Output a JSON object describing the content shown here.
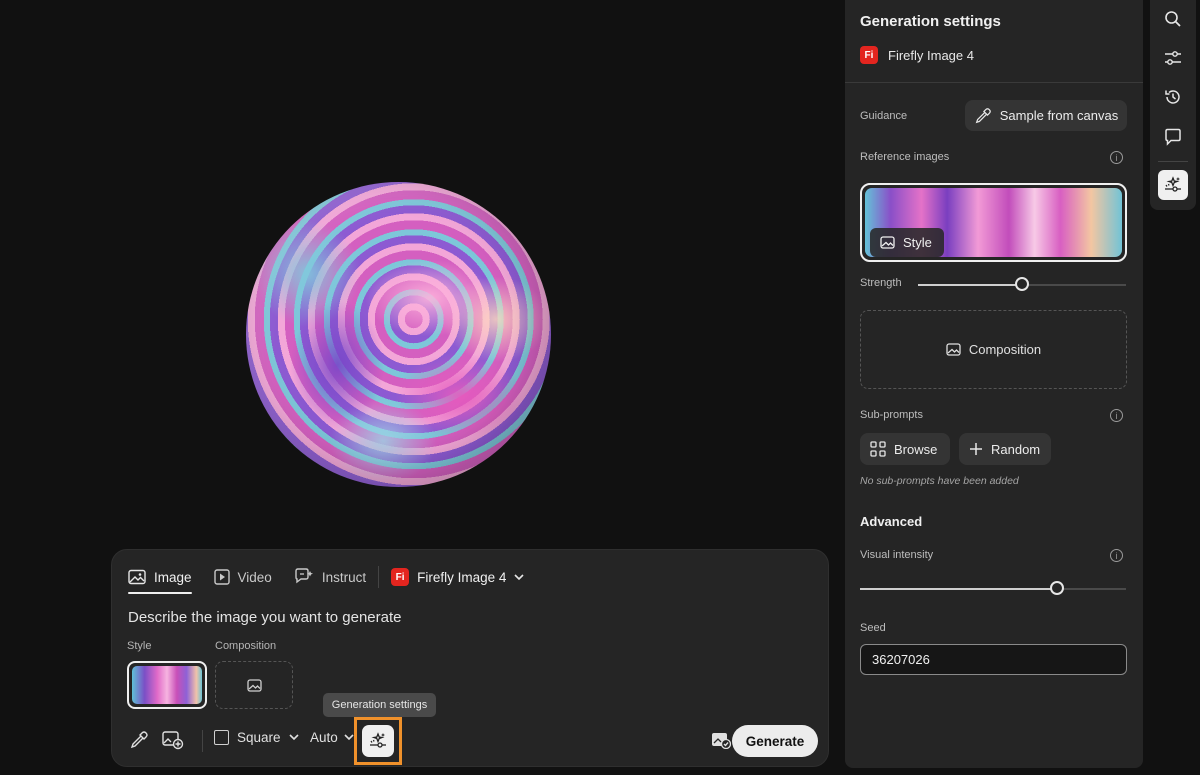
{
  "prompt_panel": {
    "tabs": [
      {
        "label": "Image",
        "icon": "image-icon",
        "active": true
      },
      {
        "label": "Video",
        "icon": "video-icon",
        "active": false
      },
      {
        "label": "Instruct",
        "icon": "instruct-icon",
        "active": false
      }
    ],
    "model": {
      "badge": "Fi",
      "label": "Firefly Image 4"
    },
    "prompt_placeholder": "Describe the image you want to generate",
    "style_label": "Style",
    "composition_label": "Composition",
    "tooltip": "Generation settings",
    "aspect_ratio": "Square",
    "content_type": "Auto",
    "generate_label": "Generate"
  },
  "settings": {
    "title": "Generation settings",
    "model": {
      "badge": "Fi",
      "label": "Firefly Image 4"
    },
    "guidance_label": "Guidance",
    "sample_button": "Sample from canvas",
    "reference_label": "Reference images",
    "style_chip": "Style",
    "strength_label": "Strength",
    "strength_value": 0.5,
    "composition_label": "Composition",
    "subprompts_label": "Sub-prompts",
    "browse_label": "Browse",
    "random_label": "Random",
    "empty_subprompts": "No sub-prompts have been added",
    "advanced_label": "Advanced",
    "visual_intensity_label": "Visual intensity",
    "visual_intensity_value": 0.74,
    "seed_label": "Seed",
    "seed_value": "36207026"
  },
  "rail": {
    "items": [
      "search-icon",
      "adjustments-icon",
      "history-icon",
      "comment-icon",
      "generation-settings-icon"
    ]
  },
  "colors": {
    "accent_highlight": "#f0912b",
    "firefly_badge": "#e3251f",
    "panel_bg": "#252525",
    "app_bg": "#111111"
  }
}
